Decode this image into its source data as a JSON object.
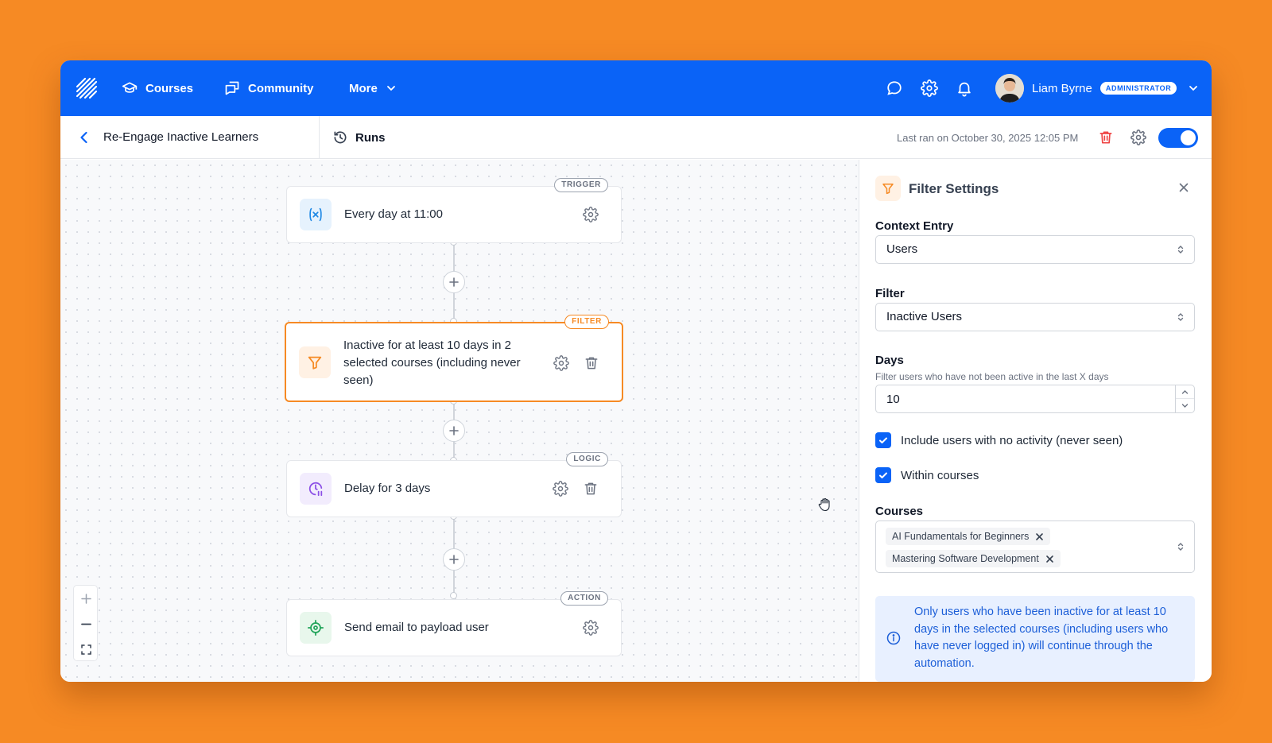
{
  "nav": {
    "items": [
      {
        "label": "Courses",
        "icon": "graduation-cap-icon"
      },
      {
        "label": "Community",
        "icon": "chat-bubbles-icon"
      },
      {
        "label": "More",
        "icon": "chevron-down-icon"
      }
    ],
    "user": {
      "name": "Liam Byrne",
      "role": "ADMINISTRATOR"
    }
  },
  "subheader": {
    "title": "Re-Engage Inactive Learners",
    "runs_label": "Runs",
    "last_ran": "Last ran on October 30, 2025 12:05 PM",
    "enabled": true
  },
  "workflow": {
    "nodes": [
      {
        "tag": "TRIGGER",
        "text": "Every day at 11:00",
        "icon": "variable-icon"
      },
      {
        "tag": "FILTER",
        "text": "Inactive for at least 10 days in 2 selected courses (including never seen)",
        "icon": "funnel-icon"
      },
      {
        "tag": "LOGIC",
        "text": "Delay for 3 days",
        "icon": "clock-pause-icon"
      },
      {
        "tag": "ACTION",
        "text": "Send email to payload user",
        "icon": "target-icon"
      }
    ]
  },
  "panel": {
    "title": "Filter Settings",
    "context_entry": {
      "label": "Context Entry",
      "value": "Users"
    },
    "filter": {
      "label": "Filter",
      "value": "Inactive Users"
    },
    "days": {
      "label": "Days",
      "hint": "Filter users who have not been active in the last X days",
      "value": "10"
    },
    "checkboxes": [
      {
        "label": "Include users with no activity (never seen)",
        "checked": true
      },
      {
        "label": "Within courses",
        "checked": true
      }
    ],
    "courses": {
      "label": "Courses",
      "selected": [
        "AI Fundamentals for Beginners",
        "Mastering Software Development"
      ]
    },
    "info": "Only users who have been inactive for at least 10 days in the selected courses (including users who have never logged in) will continue through the automation."
  },
  "colors": {
    "brand": "#0A63F7",
    "accent": "#F68A24",
    "background": "#F68A24"
  }
}
